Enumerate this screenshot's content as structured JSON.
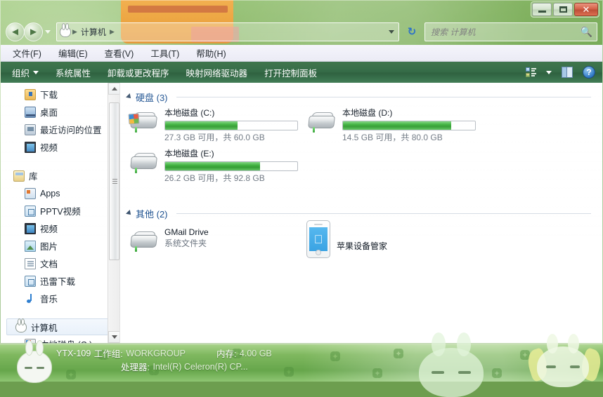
{
  "window": {
    "title": "",
    "controls": {
      "minimize": "–",
      "maximize": "□",
      "close": "✕"
    }
  },
  "address": {
    "back_label": "◄",
    "forward_label": "►",
    "root_icon": "rabbit-icon",
    "crumbs": [
      "计算机"
    ],
    "separator": "▶",
    "refresh_label": "↻",
    "dropdown": "▼"
  },
  "search": {
    "placeholder": "搜索 计算机",
    "value": "",
    "icon": "search-icon"
  },
  "menubar": {
    "items": [
      {
        "label": "文件(F)"
      },
      {
        "label": "编辑(E)"
      },
      {
        "label": "查看(V)"
      },
      {
        "label": "工具(T)"
      },
      {
        "label": "帮助(H)"
      }
    ]
  },
  "toolbar": {
    "organize_label": "组织",
    "items": [
      {
        "label": "系统属性"
      },
      {
        "label": "卸载或更改程序"
      },
      {
        "label": "映射网络驱动器"
      },
      {
        "label": "打开控制面板"
      }
    ],
    "view_icon": "view-mode-icon",
    "view_caret": "▼",
    "preview_icon": "preview-pane-icon",
    "help_icon": "help-icon",
    "help_glyph": "?"
  },
  "sidebar": {
    "items": [
      {
        "label": "下载",
        "icon": "downloads-folder-icon",
        "indent": true,
        "selected": false
      },
      {
        "label": "桌面",
        "icon": "desktop-icon",
        "indent": true,
        "selected": false
      },
      {
        "label": "最近访问的位置",
        "icon": "recent-places-icon",
        "indent": true,
        "selected": false
      },
      {
        "label": "视频",
        "icon": "video-icon",
        "indent": true,
        "selected": false
      },
      {
        "label": "库",
        "icon": "library-icon",
        "indent": false,
        "selected": false
      },
      {
        "label": "Apps",
        "icon": "apps-icon",
        "indent": true,
        "selected": false
      },
      {
        "label": "PPTV视频",
        "icon": "pptv-video-icon",
        "indent": true,
        "selected": false
      },
      {
        "label": "视频",
        "icon": "video-icon",
        "indent": true,
        "selected": false
      },
      {
        "label": "图片",
        "icon": "pictures-icon",
        "indent": true,
        "selected": false
      },
      {
        "label": "文档",
        "icon": "documents-icon",
        "indent": true,
        "selected": false
      },
      {
        "label": "迅雷下载",
        "icon": "thunder-download-icon",
        "indent": true,
        "selected": false
      },
      {
        "label": "音乐",
        "icon": "music-icon",
        "indent": true,
        "selected": false
      },
      {
        "label": "计算机",
        "icon": "computer-rabbit-icon",
        "indent": false,
        "selected": true
      },
      {
        "label": "本地磁盘 (C:)",
        "icon": "local-disk-c-icon",
        "indent": true,
        "selected": false
      }
    ],
    "scrollbar": {
      "up": "▲",
      "down": "▼"
    }
  },
  "main": {
    "sections": [
      {
        "title": "硬盘 (3)",
        "collapse_glyph": "◢",
        "tiles": [
          {
            "name": "本地磁盘 (C:)",
            "sub": "27.3 GB 可用，共 60.0 GB",
            "free_gb": 27.3,
            "total_gb": 60.0,
            "used_percent": 55,
            "icon": "hard-drive-windows-icon",
            "has_windows_badge": true
          },
          {
            "name": "本地磁盘 (D:)",
            "sub": "14.5 GB 可用，共 80.0 GB",
            "free_gb": 14.5,
            "total_gb": 80.0,
            "used_percent": 82,
            "icon": "hard-drive-icon",
            "has_windows_badge": false
          },
          {
            "name": "本地磁盘 (E:)",
            "sub": "26.2 GB 可用，共 92.8 GB",
            "free_gb": 26.2,
            "total_gb": 92.8,
            "used_percent": 72,
            "icon": "hard-drive-icon",
            "has_windows_badge": false
          }
        ]
      },
      {
        "title": "其他 (2)",
        "collapse_glyph": "◢",
        "tiles": [
          {
            "name": "GMail Drive",
            "sub": "系统文件夹",
            "icon": "hard-drive-icon"
          },
          {
            "name": "苹果设备管家",
            "sub": "",
            "icon": "iphone-apple-icon",
            "apple_glyph": ""
          }
        ]
      }
    ]
  },
  "statusbar": {
    "computer_name": "YTX-109",
    "workgroup_label": "工作组:",
    "workgroup_value": "WORKGROUP",
    "memory_label": "内存:",
    "memory_value": "4.00 GB",
    "processor_label": "处理器:",
    "processor_value": "Intel(R) Celeron(R) CP..."
  },
  "colors": {
    "toolbar_green": "#27613a",
    "section_title_blue": "#1a4f8f",
    "progress_green": "#3cb13c",
    "close_red": "#cf4f33",
    "desktop_green": "#76ab51"
  }
}
